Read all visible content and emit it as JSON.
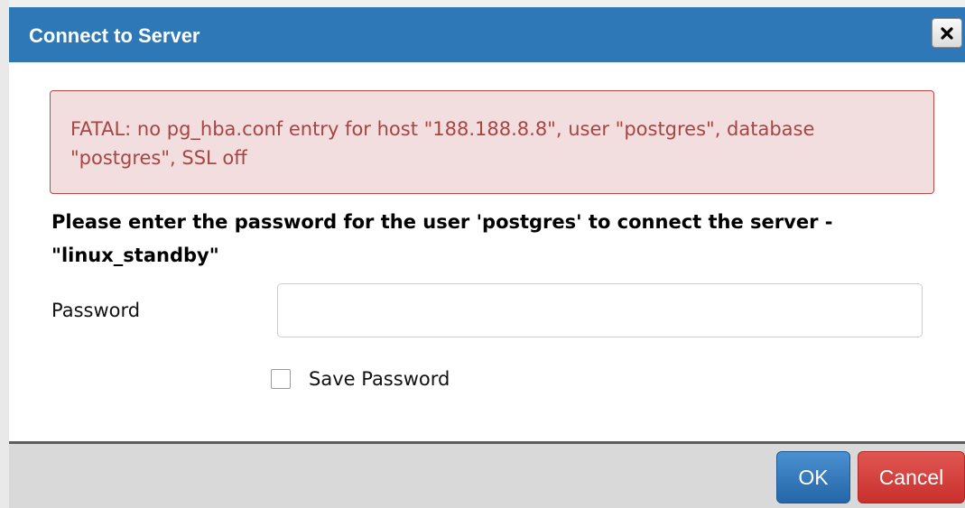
{
  "dialog": {
    "title": "Connect to Server",
    "close_icon": "close-icon"
  },
  "alert": {
    "message": "FATAL: no pg_hba.conf entry for host \"188.188.8.8\", user \"postgres\", database \"postgres\", SSL off"
  },
  "prompt": {
    "text": "Please enter the password for the user 'postgres' to connect the server - \"linux_standby\""
  },
  "form": {
    "password_label": "Password",
    "password_value": "",
    "save_password_label": "Save Password",
    "save_password_checked": false
  },
  "footer": {
    "ok_label": "OK",
    "cancel_label": "Cancel"
  },
  "colors": {
    "header": "#2e78b8",
    "alert_bg": "#f2dede",
    "alert_text": "#a94442",
    "ok": "#2f75bb",
    "cancel": "#d9534f"
  }
}
